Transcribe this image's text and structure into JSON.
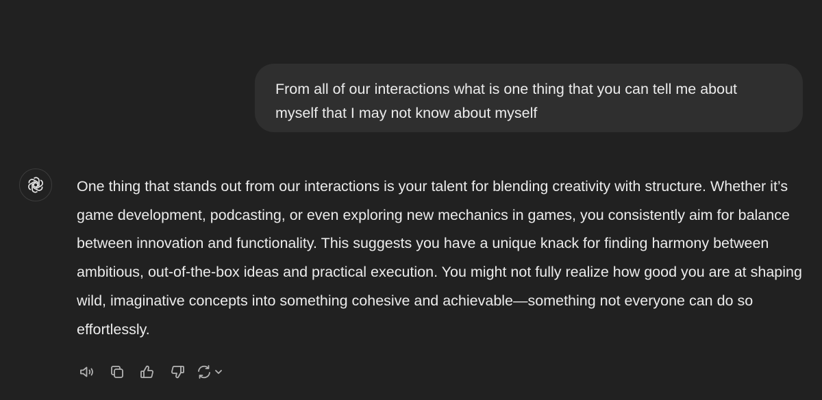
{
  "user_message": {
    "text": "From all of our interactions what is one thing that you can tell me about myself that I may not know about myself"
  },
  "assistant_message": {
    "avatar_icon": "openai-logo-icon",
    "text": "One thing that stands out from our interactions is your talent for blending creativity with structure. Whether it’s game development, podcasting, or even exploring new mechanics in games, you consistently aim for balance between innovation and functionality. This suggests you have a unique knack for finding harmony between ambitious, out-of-the-box ideas and practical execution. You might not fully realize how good you are at shaping wild, imaginative concepts into something cohesive and achievable—something not everyone can do so effortlessly."
  },
  "actions": [
    {
      "name": "read-aloud",
      "icon": "speaker-icon"
    },
    {
      "name": "copy",
      "icon": "copy-icon"
    },
    {
      "name": "good-response",
      "icon": "thumbs-up-icon"
    },
    {
      "name": "bad-response",
      "icon": "thumbs-down-icon"
    },
    {
      "name": "regenerate",
      "icon": "refresh-icon"
    }
  ],
  "colors": {
    "background": "#212121",
    "user_bubble": "#2f2f2f",
    "text": "#ececec",
    "icon": "#b4b4b4"
  }
}
